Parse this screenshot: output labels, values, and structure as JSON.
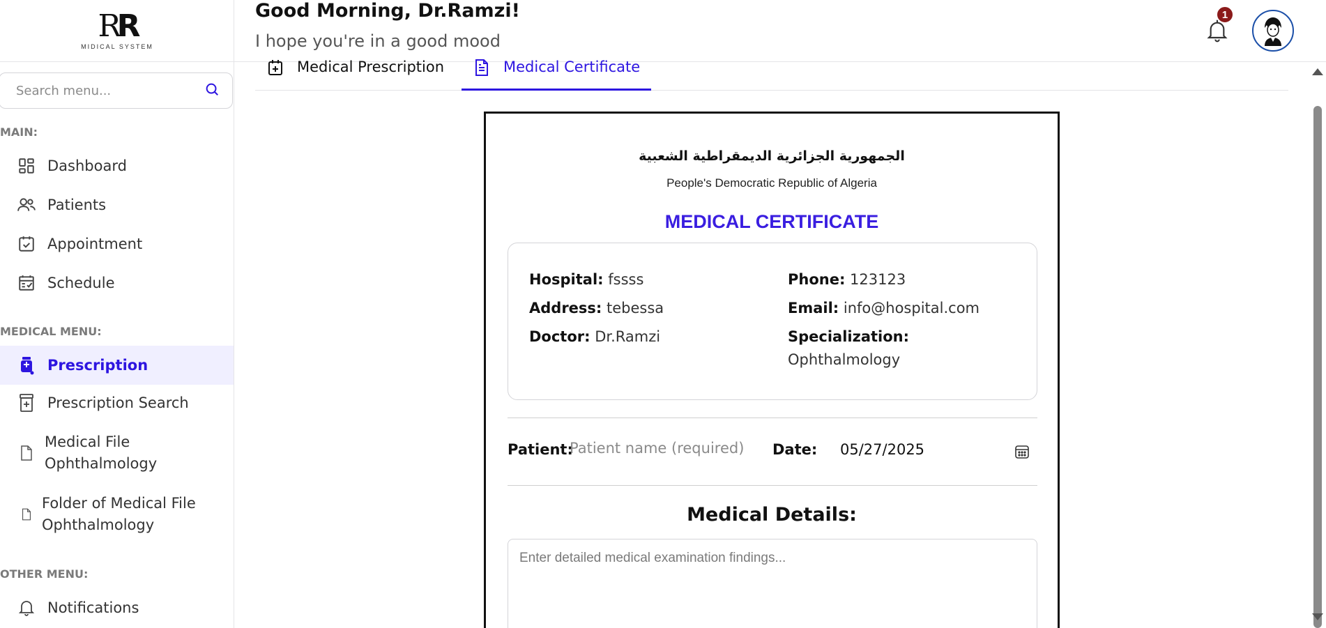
{
  "logo": {
    "mark_left": "R",
    "mark_right": "R",
    "subtitle": "MIDICAL SYSTEM"
  },
  "search": {
    "placeholder": "Search menu..."
  },
  "sidebar": {
    "main_label": "MAIN:",
    "main_items": [
      {
        "label": "Dashboard",
        "icon": "dashboard-icon"
      },
      {
        "label": "Patients",
        "icon": "users-icon"
      },
      {
        "label": "Appointment",
        "icon": "calendar-check-icon"
      },
      {
        "label": "Schedule",
        "icon": "schedule-icon"
      }
    ],
    "medical_label": "MEDICAL MENU:",
    "medical_items": [
      {
        "label": "Prescription",
        "icon": "pill-bottle-icon",
        "active": true
      },
      {
        "label": "Prescription Search",
        "icon": "prescription-jar-icon"
      },
      {
        "label_line1": "Medical File",
        "label_line2": "Ophthalmology",
        "icon": "file-icon"
      },
      {
        "label_line1": "Folder of Medical File",
        "label_line2": "Ophthalmology",
        "icon": "file-icon"
      }
    ],
    "other_label": "OTHER MENU:",
    "other_items": [
      {
        "label": "Notifications",
        "icon": "bell-icon"
      }
    ]
  },
  "header": {
    "greeting": "Good Morning, Dr.Ramzi!",
    "subtitle": "I hope you're in a good mood",
    "notification_count": "1"
  },
  "tabs": [
    {
      "label": "Medical Prescription",
      "icon": "calendar-plus-icon",
      "active": false
    },
    {
      "label": "Medical Certificate",
      "icon": "document-icon",
      "active": true
    }
  ],
  "certificate": {
    "arabic_title": "الجمهورية الجزائرية الديمقراطية الشعبية",
    "english_title": "People's Democratic Republic of Algeria",
    "title": "MEDICAL CERTIFICATE",
    "hospital_label": "Hospital:",
    "hospital": "fssss",
    "address_label": "Address:",
    "address": "tebessa",
    "doctor_label": "Doctor:",
    "doctor": "Dr.Ramzi",
    "phone_label": "Phone:",
    "phone": "123123",
    "email_label": "Email:",
    "email": "info@hospital.com",
    "specialization_label": "Specialization:",
    "specialization": "Ophthalmology",
    "patient_label": "Patient:",
    "patient_placeholder": "Patient name (required)",
    "date_label": "Date:",
    "date": "05/27/2025",
    "details_title": "Medical Details:",
    "details_placeholder": "Enter detailed medical examination findings..."
  },
  "colors": {
    "accent": "#2d15e0",
    "active_bg": "#f0efff",
    "badge": "#8b1a1a",
    "avatar_ring": "#1b4fa8"
  }
}
